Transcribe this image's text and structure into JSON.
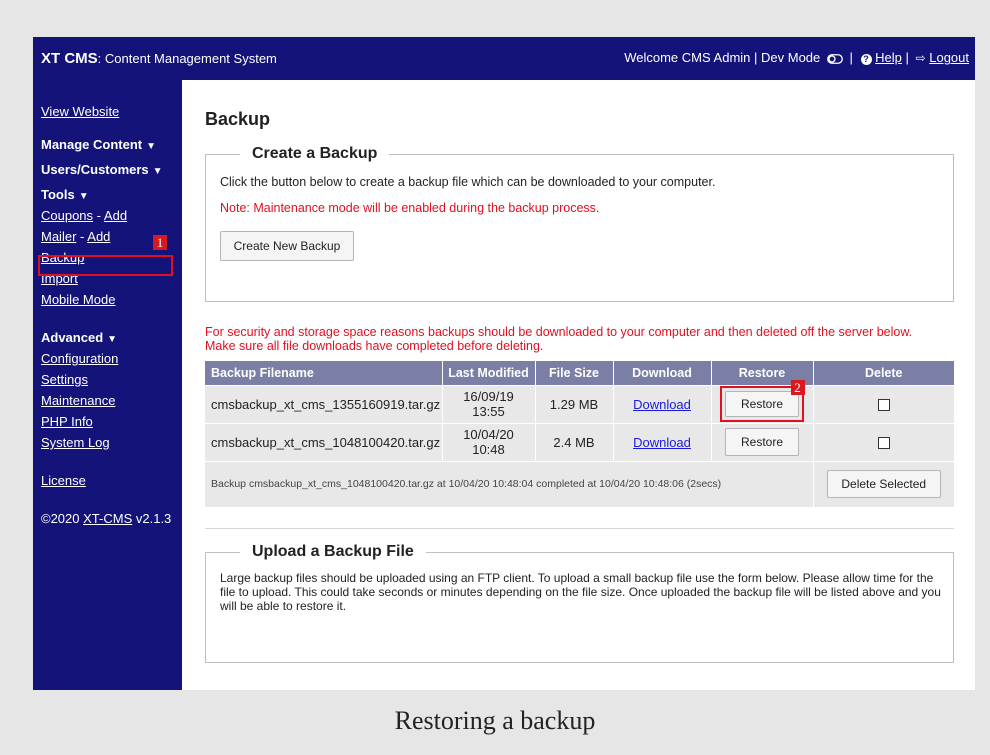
{
  "topbar": {
    "brand": "XT CMS",
    "tagline": ": Content Management System",
    "welcome": "Welcome CMS Admin | Dev Mode",
    "toggle_icon": "toggle-icon",
    "help_label": "Help",
    "logout_label": "Logout",
    "separator": "|"
  },
  "sidebar": {
    "view_website": "View Website",
    "manage_content": "Manage Content",
    "users_customers": "Users/Customers",
    "tools": "Tools",
    "coupons": "Coupons",
    "coupons_add": "Add",
    "mailer": "Mailer",
    "mailer_add": "Add",
    "dash": "-",
    "backup": "Backup",
    "import": "Import",
    "mobile_mode": "Mobile Mode",
    "advanced": "Advanced",
    "configuration": "Configuration",
    "settings": "Settings",
    "maintenance": "Maintenance",
    "php_info": "PHP Info",
    "system_log": "System Log",
    "license": "License",
    "copyright_prefix": "©2020",
    "copyright_link": "XT-CMS",
    "version": "v2.1.3"
  },
  "annotations": {
    "one": "1",
    "two": "2"
  },
  "main": {
    "title": "Backup",
    "create": {
      "legend": "Create a Backup",
      "description": "Click the button below to create a backup file which can be downloaded to your computer.",
      "note": "Note: Maintenance mode will be enabled during the backup process.",
      "button": "Create New Backup"
    },
    "security_note_1": "For security and storage space reasons backups should be downloaded to your computer and then deleted off the server below.",
    "security_note_2": "Make sure all file downloads have completed before deleting.",
    "table": {
      "headers": [
        "Backup Filename",
        "Last Modified",
        "File Size",
        "Download",
        "Restore",
        "Delete"
      ],
      "rows": [
        {
          "filename": "cmsbackup_xt_cms_1355160919.tar.gz",
          "date": "16/09/19",
          "time": "13:55",
          "size": "1.29 MB",
          "download": "Download",
          "restore": "Restore"
        },
        {
          "filename": "cmsbackup_xt_cms_1048100420.tar.gz",
          "date": "10/04/20",
          "time": "10:48",
          "size": "2.4 MB",
          "download": "Download",
          "restore": "Restore"
        }
      ],
      "status": "Backup cmsbackup_xt_cms_1048100420.tar.gz at 10/04/20 10:48:04 completed at 10/04/20 10:48:06 (2secs)",
      "delete_selected": "Delete Selected"
    },
    "upload": {
      "legend": "Upload a Backup File",
      "description": "Large backup files should be uploaded using an FTP client. To upload a small backup file use the form below. Please allow time for the file to upload. This could take seconds or minutes depending on the file size. Once uploaded the backup file will be listed above and you will be able to restore it."
    }
  },
  "caption": "Restoring a backup",
  "colors": {
    "nav": "#14137a",
    "highlight": "#e01020",
    "table_header": "#7b7fa6"
  }
}
